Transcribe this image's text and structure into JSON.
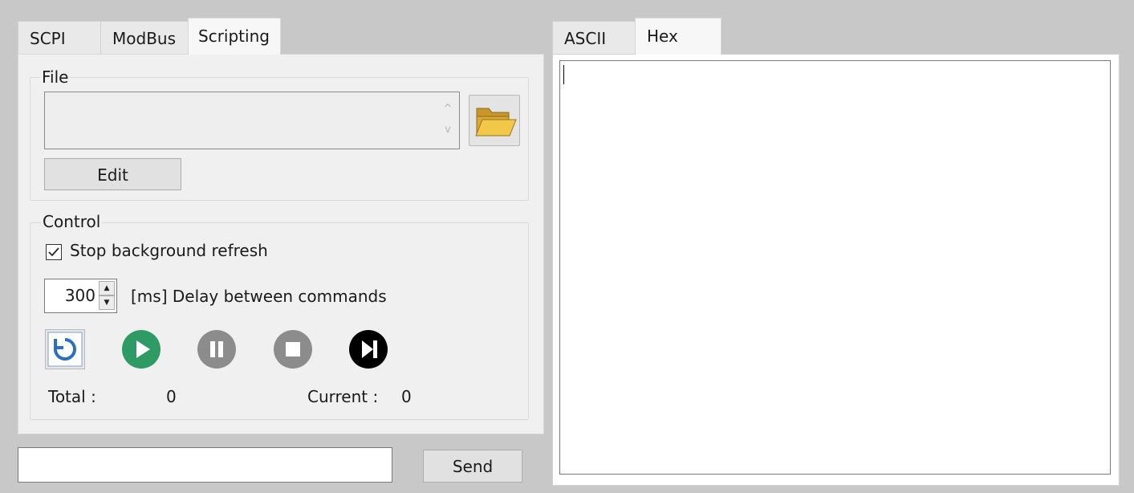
{
  "left_tabs": [
    {
      "label": "SCPI",
      "active": false
    },
    {
      "label": "ModBus",
      "active": false
    },
    {
      "label": "Scripting",
      "active": true
    }
  ],
  "right_tabs": [
    {
      "label": "ASCII",
      "active": false
    },
    {
      "label": "Hex",
      "active": true
    }
  ],
  "file_group": {
    "title": "File",
    "file_value": "",
    "edit_label": "Edit",
    "browse_icon": "folder-open-icon"
  },
  "control_group": {
    "title": "Control",
    "stop_refresh_label": "Stop background refresh",
    "stop_refresh_checked": true,
    "delay_value": "300",
    "delay_label": "[ms] Delay between commands",
    "buttons": [
      "reload-icon",
      "play-icon",
      "pause-icon",
      "stop-icon",
      "step-icon"
    ],
    "total_label": "Total :",
    "total_value": "0",
    "current_label": "Current :",
    "current_value": "0"
  },
  "command": {
    "value": "",
    "send_label": "Send"
  },
  "output": {
    "text": ""
  },
  "colors": {
    "play": "#2e9a64",
    "inactive": "#8c8c8c",
    "step": "#000000",
    "reload_blue": "#2a6fc0",
    "folder": "#e2b53c"
  }
}
